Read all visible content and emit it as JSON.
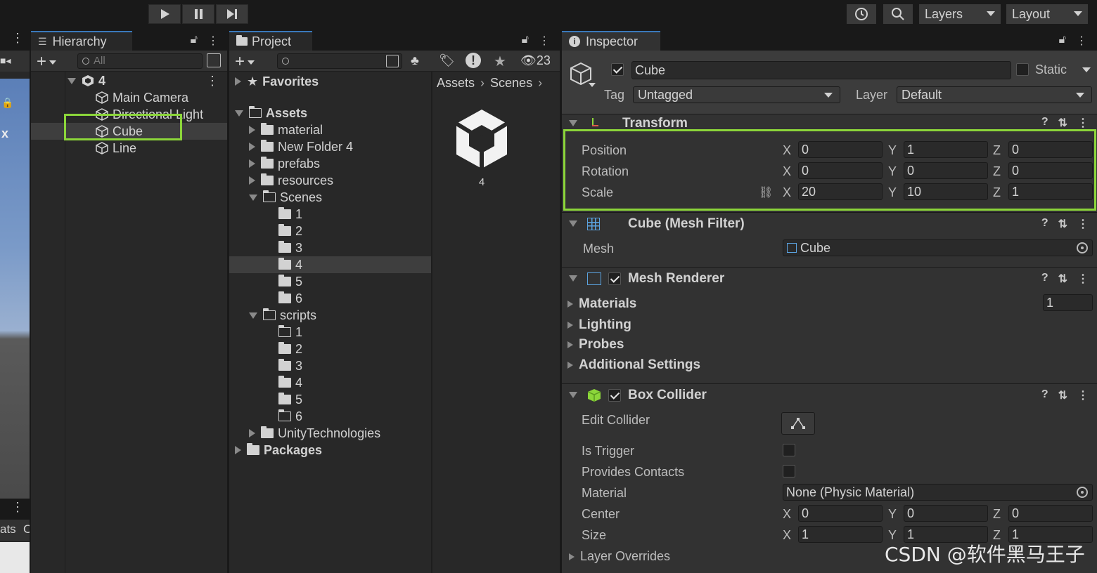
{
  "toolbar": {
    "layers_label": "Layers",
    "layout_label": "Layout"
  },
  "hierarchy": {
    "tab_label": "Hierarchy",
    "search_placeholder": "All",
    "scene_name": "4",
    "items": [
      {
        "label": "Main Camera"
      },
      {
        "label": "Directional Light"
      },
      {
        "label": "Cube"
      },
      {
        "label": "Line"
      }
    ]
  },
  "project": {
    "tab_label": "Project",
    "hidden_count": "23",
    "favorites_label": "Favorites",
    "assets_label": "Assets",
    "asset_folders": [
      "material",
      "New Folder 4",
      "prefabs",
      "resources"
    ],
    "scenes_label": "Scenes",
    "scene_folders": [
      "1",
      "2",
      "3",
      "4",
      "5",
      "6"
    ],
    "scripts_label": "scripts",
    "script_folders": [
      "1",
      "2",
      "3",
      "4",
      "5",
      "6"
    ],
    "unity_tech_label": "UnityTechnologies",
    "packages_label": "Packages",
    "breadcrumb": [
      "Assets",
      "Scenes"
    ],
    "asset_item_label": "4"
  },
  "left_strip": {
    "text_x": "x",
    "text_ats": "ats",
    "text_c": "C"
  },
  "inspector": {
    "tab_label": "Inspector",
    "object_name": "Cube",
    "static_label": "Static",
    "tag_label": "Tag",
    "tag_value": "Untagged",
    "layer_label": "Layer",
    "layer_value": "Default",
    "transform": {
      "title": "Transform",
      "position_label": "Position",
      "rotation_label": "Rotation",
      "scale_label": "Scale",
      "position": {
        "x": "0",
        "y": "1",
        "z": "0"
      },
      "rotation": {
        "x": "0",
        "y": "0",
        "z": "0"
      },
      "scale": {
        "x": "20",
        "y": "10",
        "z": "1"
      }
    },
    "mesh_filter": {
      "title": "Cube (Mesh Filter)",
      "mesh_label": "Mesh",
      "mesh_value": "Cube"
    },
    "mesh_renderer": {
      "title": "Mesh Renderer",
      "materials_label": "Materials",
      "materials_count": "1",
      "lighting_label": "Lighting",
      "probes_label": "Probes",
      "additional_label": "Additional Settings"
    },
    "box_collider": {
      "title": "Box Collider",
      "edit_collider_label": "Edit Collider",
      "is_trigger_label": "Is Trigger",
      "provides_contacts_label": "Provides Contacts",
      "material_label": "Material",
      "material_value": "None (Physic Material)",
      "center_label": "Center",
      "size_label": "Size",
      "layer_overrides_label": "Layer Overrides",
      "center": {
        "x": "0",
        "y": "0",
        "z": "0"
      },
      "size": {
        "x": "1",
        "y": "1",
        "z": "1"
      }
    },
    "axis": {
      "x": "X",
      "y": "Y",
      "z": "Z"
    }
  },
  "watermark": "CSDN @软件黑马王子",
  "colors": {
    "highlight_box": "#8cd63a",
    "tab_accent": "#3a79bb",
    "panel_bg": "#282828"
  }
}
